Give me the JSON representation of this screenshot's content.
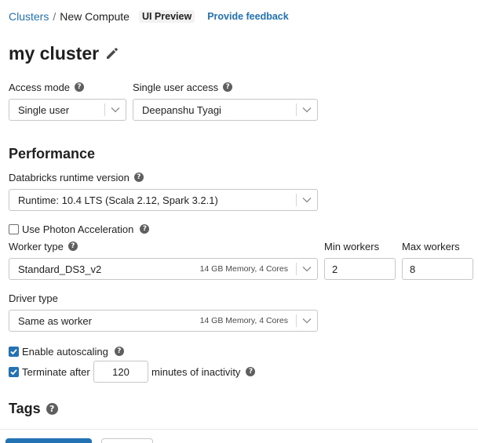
{
  "breadcrumb": {
    "root": "Clusters",
    "separator": "/",
    "current": "New Compute",
    "badge": "UI Preview",
    "feedback_link": "Provide feedback"
  },
  "page": {
    "title": "my cluster",
    "edit_icon": "pencil-icon"
  },
  "access": {
    "access_mode_label": "Access mode",
    "access_mode_value": "Single user",
    "single_user_label": "Single user access",
    "single_user_value": "Deepanshu Tyagi"
  },
  "performance": {
    "section_title": "Performance",
    "runtime_label": "Databricks runtime version",
    "runtime_value": "Runtime: 10.4 LTS (Scala 2.12, Spark 3.2.1)",
    "photon_label": "Use Photon Acceleration",
    "photon_checked": false,
    "worker_type_label": "Worker type",
    "worker_type_value": "Standard_DS3_v2",
    "worker_type_meta": "14 GB Memory, 4 Cores",
    "min_workers_label": "Min workers",
    "min_workers_value": "2",
    "max_workers_label": "Max workers",
    "max_workers_value": "8",
    "driver_type_label": "Driver type",
    "driver_type_value": "Same as worker",
    "driver_type_meta": "14 GB Memory, 4 Cores",
    "autoscaling_label": "Enable autoscaling",
    "autoscaling_checked": true,
    "terminate_label": "Terminate after",
    "terminate_checked": true,
    "terminate_minutes": "120",
    "terminate_suffix": "minutes of inactivity"
  },
  "tags": {
    "section_title": "Tags"
  },
  "icons": {
    "help": "question-circle-icon",
    "chevron": "chevron-down-icon",
    "check": "checkmark-icon"
  },
  "colors": {
    "link": "#2272b4",
    "primary_button": "#2272b4",
    "badge_bg": "#f2f2f2"
  }
}
